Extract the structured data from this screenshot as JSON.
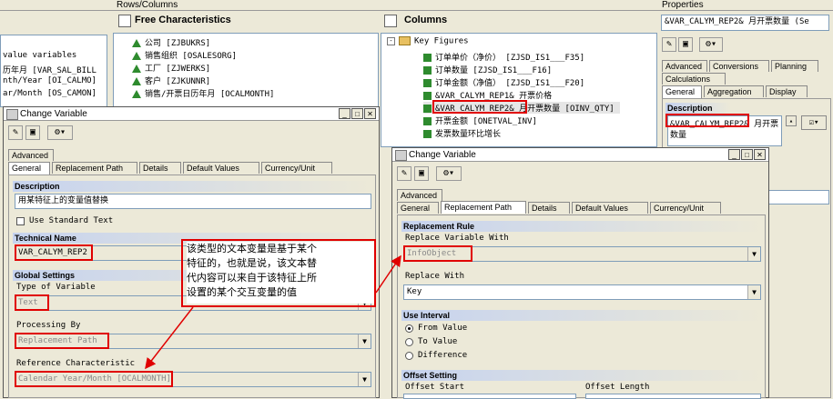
{
  "top": {
    "rows_columns": "Rows/Columns",
    "properties": "Properties"
  },
  "left_panel": {
    "lines": [
      "value variables",
      "历年月 [VAR_SAL_BILL",
      "nth/Year [OI_CALMO]",
      "ar/Month [OS_CAMON]"
    ]
  },
  "free_characteristics": {
    "title": "Free Characteristics",
    "items": [
      "公司 [ZJBUKRS]",
      "销售组织 [OSALESORG]",
      "工厂 [ZJWERKS]",
      "客户 [ZJKUNNR]",
      "销售/开票日历年月 [OCALMONTH]"
    ]
  },
  "columns": {
    "title": "Columns",
    "root": "Key Figures",
    "items": [
      "订单单价（净价） [ZJSD_IS1___F35]",
      "订单数量 [ZJSD_IS1___F16]",
      "订单金额（净值） [ZJSD_IS1___F20]",
      "&VAR_CALYM_REP1& 开票价格",
      "&VAR_CALYM_REP2& 月开票数量 [OINV_QTY]",
      "开票金额 [ONETVAL_INV]",
      "发票数量环比增长"
    ]
  },
  "properties": {
    "selector": "&VAR_CALYM_REP2& 月开票数量 (Se",
    "tabs_row1": [
      "Advanced",
      "Conversions",
      "Planning"
    ],
    "tabs_row2": [
      "Calculations"
    ],
    "tabs_row3": [
      "General",
      "Aggregation",
      "Display"
    ],
    "description_group": "Description",
    "description_value": "&VAR_CALYM_REP2& 月开票",
    "description_value2": "数量"
  },
  "dialog1": {
    "title": "Change Variable",
    "tabs_row1": [
      "Advanced"
    ],
    "tabs_row2": [
      "General",
      "Replacement Path",
      "Details",
      "Default Values",
      "Currency/Unit"
    ],
    "description_group": "Description",
    "description_value": "用某特征上的变量值替换",
    "use_standard_text": "Use Standard Text",
    "technical_name_group": "Technical Name",
    "technical_name": "VAR_CALYM_REP2",
    "global_settings_group": "Global Settings",
    "type_label": "Type of Variable",
    "type_value": "Text",
    "processing_label": "Processing By",
    "processing_value": "Replacement Path",
    "ref_char_label": "Reference Characteristic",
    "ref_char_value": "Calendar Year/Month [OCALMONTH]"
  },
  "dialog2": {
    "title": "Change Variable",
    "tabs_row1": [
      "Advanced"
    ],
    "tabs_row2": [
      "General",
      "Replacement Path",
      "Details",
      "Default Values",
      "Currency/Unit"
    ],
    "replacement_rule_group": "Replacement Rule",
    "replace_variable_with_label": "Replace Variable With",
    "replace_variable_with_value": "InfoObject",
    "replace_with_label": "Replace With",
    "replace_with_value": "Key",
    "use_interval_group": "Use Interval",
    "radio_from": "From Value",
    "radio_to": "To Value",
    "radio_diff": "Difference",
    "offset_group": "Offset Setting",
    "offset_start": "Offset Start",
    "offset_length": "Offset Length"
  },
  "annotation": {
    "lines": [
      "该类型的文本变量是基于某个",
      "特征的，也就是说，该文本替",
      "代内容可以来自于该特征上所",
      "设置的某个交互变量的值"
    ]
  },
  "colors": {
    "highlight": "#e00000",
    "title_bar": "#ffffff",
    "group_header": "#c6d3ef"
  }
}
